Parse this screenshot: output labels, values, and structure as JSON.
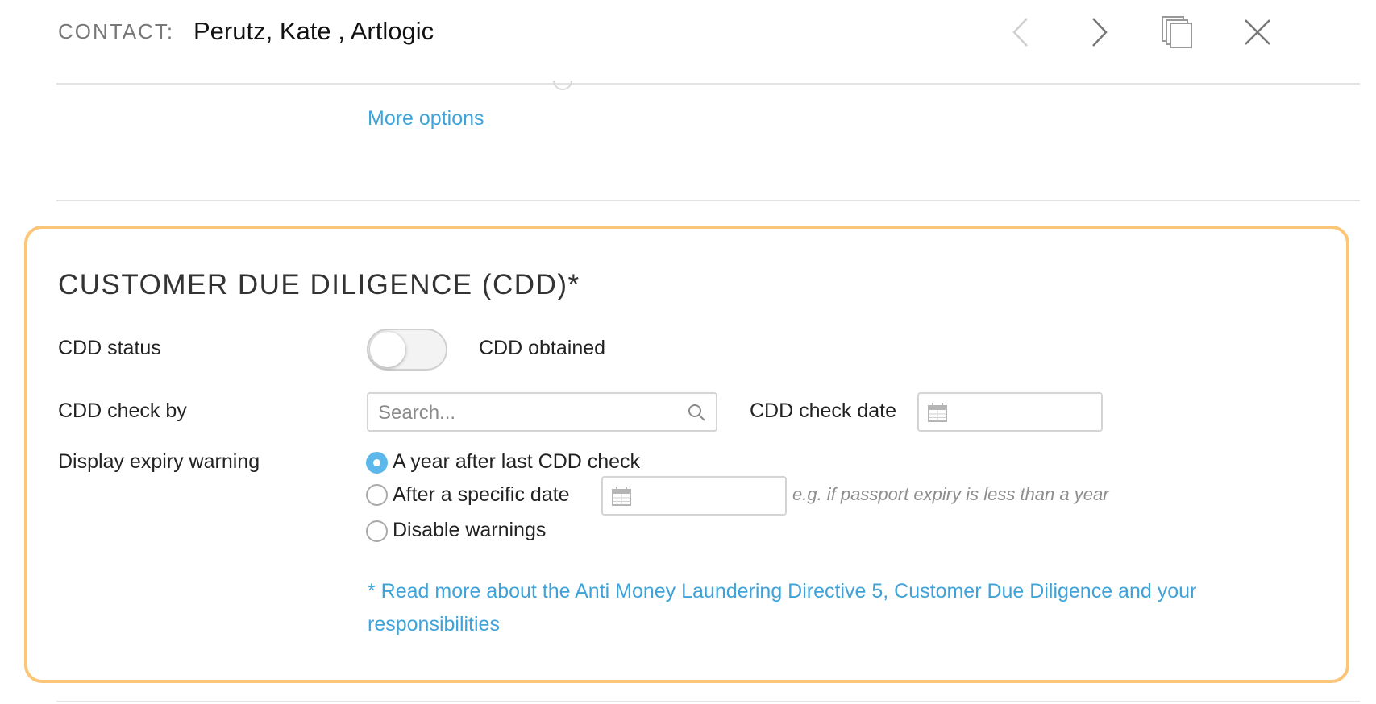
{
  "header": {
    "label": "CONTACT:",
    "name": "Perutz, Kate , Artlogic",
    "icons": [
      "chevron-left-icon",
      "chevron-right-icon",
      "duplicate-icon",
      "close-icon"
    ]
  },
  "more_options": "More options",
  "cdd": {
    "title": "CUSTOMER DUE DILIGENCE (CDD)*",
    "status_label": "CDD status",
    "status_toggle_text": "CDD obtained",
    "status_toggle_on": false,
    "check_by_label": "CDD check by",
    "search_placeholder": "Search...",
    "check_date_label": "CDD check date",
    "expiry_label": "Display expiry warning",
    "expiry_options": [
      {
        "label": "A year after last CDD check",
        "checked": true
      },
      {
        "label": "After a specific date",
        "checked": false
      },
      {
        "label": "Disable warnings",
        "checked": false
      }
    ],
    "specific_date_hint": "e.g. if passport expiry is less than a year",
    "aml_link": "* Read more about the Anti Money Laundering Directive 5, Customer Due Diligence and your responsibilities"
  },
  "colors": {
    "accent": "#3fa3d9",
    "radio_checked": "#5cb8ea",
    "highlight_border": "#fcc679",
    "divider": "#e3e3e3"
  }
}
